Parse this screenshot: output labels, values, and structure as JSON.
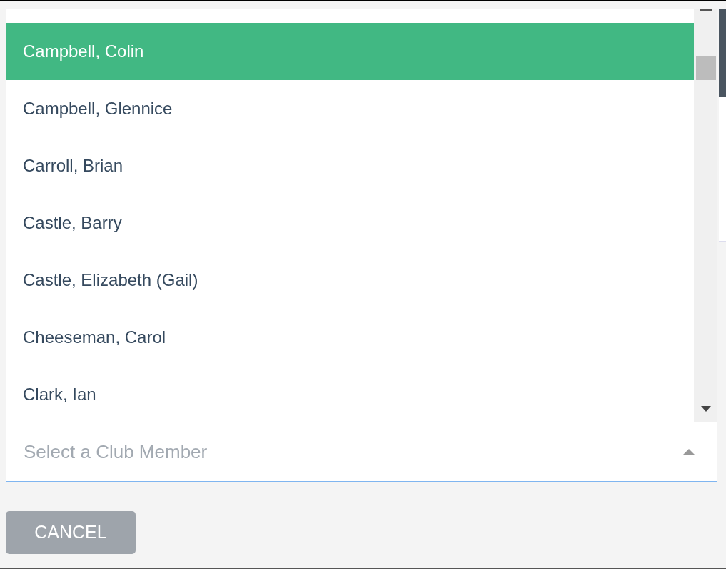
{
  "options": [
    {
      "label": "Campbell, Colin",
      "selected": true
    },
    {
      "label": "Campbell, Glennice",
      "selected": false
    },
    {
      "label": "Carroll, Brian",
      "selected": false
    },
    {
      "label": "Castle, Barry",
      "selected": false
    },
    {
      "label": "Castle, Elizabeth (Gail)",
      "selected": false
    },
    {
      "label": "Cheeseman, Carol",
      "selected": false
    },
    {
      "label": "Clark, Ian",
      "selected": false
    }
  ],
  "select": {
    "placeholder": "Select a Club Member",
    "expanded": true
  },
  "buttons": [
    "CANCEL"
  ]
}
